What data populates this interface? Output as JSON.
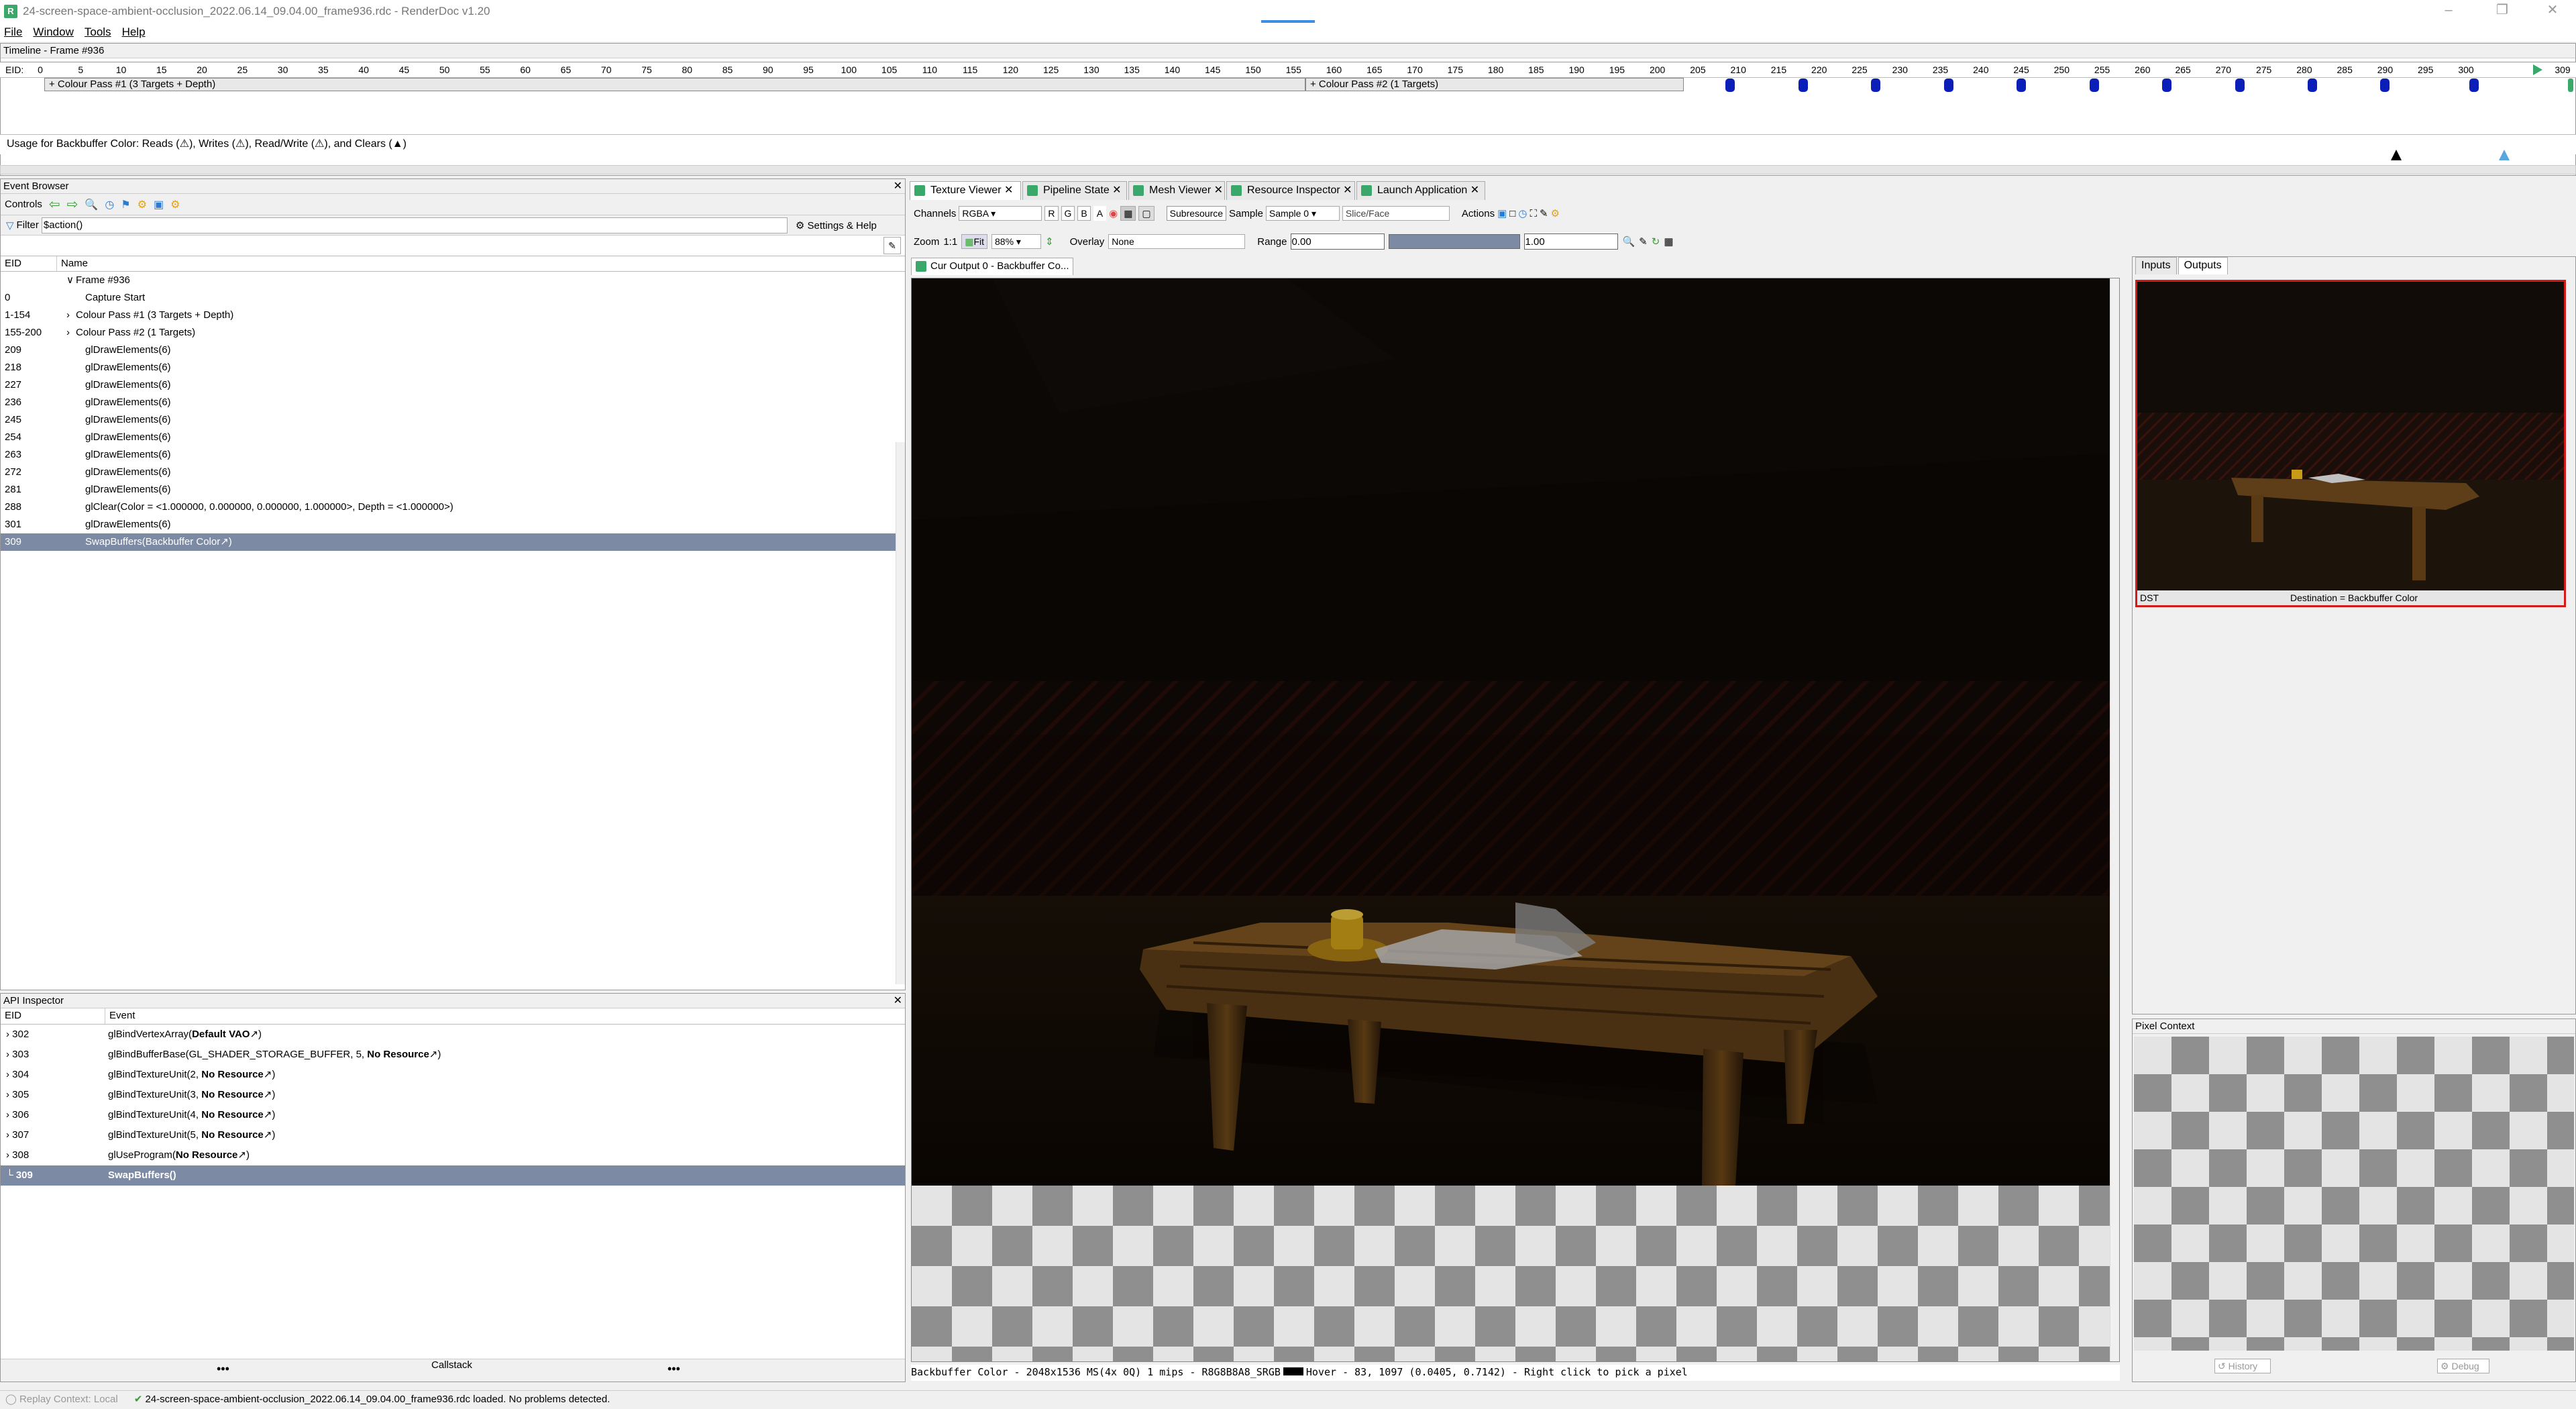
{
  "window": {
    "title": "24-screen-space-ambient-occlusion_2022.06.14_09.04.00_frame936.rdc - RenderDoc v1.20",
    "app_icon": "renderdoc-icon"
  },
  "menu": [
    "File",
    "Window",
    "Tools",
    "Help"
  ],
  "timeline": {
    "title": "Timeline - Frame #936",
    "eid_label": "EID:",
    "ticks": [
      "0",
      "5",
      "10",
      "15",
      "20",
      "25",
      "30",
      "35",
      "40",
      "45",
      "50",
      "55",
      "60",
      "65",
      "70",
      "75",
      "80",
      "85",
      "90",
      "95",
      "100",
      "105",
      "110",
      "115",
      "120",
      "125",
      "130",
      "135",
      "140",
      "145",
      "150",
      "155",
      "160",
      "165",
      "170",
      "175",
      "180",
      "185",
      "190",
      "195",
      "200",
      "205",
      "210",
      "215",
      "220",
      "225",
      "230",
      "235",
      "240",
      "245",
      "250",
      "255",
      "260",
      "265",
      "270",
      "275",
      "280",
      "285",
      "290",
      "295",
      "300",
      "309"
    ],
    "pass1": "+ Colour Pass #1 (3 Targets + Depth)",
    "pass2": "+ Colour Pass #2 (1 Targets)",
    "usage": "Usage for Backbuffer Color: Reads (⚠), Writes (⚠), Read/Write (⚠), and Clears (▲)"
  },
  "event_browser": {
    "title": "Event Browser",
    "controls_label": "Controls",
    "filter_label": "Filter",
    "filter_value": "$action()",
    "settings_label": "Settings & Help",
    "col_eid": "EID",
    "col_name": "Name",
    "rows": [
      {
        "eid": "",
        "name": "Frame #936",
        "indent": 1,
        "expander": "∨"
      },
      {
        "eid": "0",
        "name": "Capture Start",
        "indent": 2,
        "expander": ""
      },
      {
        "eid": "1-154",
        "name": "Colour Pass #1 (3 Targets + Depth)",
        "indent": 1,
        "expander": "›"
      },
      {
        "eid": "155-200",
        "name": "Colour Pass #2 (1 Targets)",
        "indent": 1,
        "expander": "›"
      },
      {
        "eid": "209",
        "name": "glDrawElements(6)",
        "indent": 2,
        "expander": ""
      },
      {
        "eid": "218",
        "name": "glDrawElements(6)",
        "indent": 2,
        "expander": ""
      },
      {
        "eid": "227",
        "name": "glDrawElements(6)",
        "indent": 2,
        "expander": ""
      },
      {
        "eid": "236",
        "name": "glDrawElements(6)",
        "indent": 2,
        "expander": ""
      },
      {
        "eid": "245",
        "name": "glDrawElements(6)",
        "indent": 2,
        "expander": ""
      },
      {
        "eid": "254",
        "name": "glDrawElements(6)",
        "indent": 2,
        "expander": ""
      },
      {
        "eid": "263",
        "name": "glDrawElements(6)",
        "indent": 2,
        "expander": ""
      },
      {
        "eid": "272",
        "name": "glDrawElements(6)",
        "indent": 2,
        "expander": ""
      },
      {
        "eid": "281",
        "name": "glDrawElements(6)",
        "indent": 2,
        "expander": ""
      },
      {
        "eid": "288",
        "name": "glClear(Color = <1.000000, 0.000000, 0.000000, 1.000000>, Depth = <1.000000>)",
        "indent": 2,
        "expander": ""
      },
      {
        "eid": "301",
        "name": "glDrawElements(6)",
        "indent": 2,
        "expander": ""
      },
      {
        "eid": "309",
        "name": "SwapBuffers(Backbuffer Color↗)",
        "indent": 2,
        "expander": "",
        "selected": true
      }
    ]
  },
  "api_inspector": {
    "title": "API Inspector",
    "col_eid": "EID",
    "col_event": "Event",
    "rows": [
      {
        "eid": "302",
        "pre": "glBindVertexArray(",
        "bold": "Default VAO",
        "post": "↗)"
      },
      {
        "eid": "303",
        "pre": "glBindBufferBase(GL_SHADER_STORAGE_BUFFER, 5, ",
        "bold": "No Resource",
        "post": "↗)"
      },
      {
        "eid": "304",
        "pre": "glBindTextureUnit(2, ",
        "bold": "No Resource",
        "post": "↗)"
      },
      {
        "eid": "305",
        "pre": "glBindTextureUnit(3, ",
        "bold": "No Resource",
        "post": "↗)"
      },
      {
        "eid": "306",
        "pre": "glBindTextureUnit(4, ",
        "bold": "No Resource",
        "post": "↗)"
      },
      {
        "eid": "307",
        "pre": "glBindTextureUnit(5, ",
        "bold": "No Resource",
        "post": "↗)"
      },
      {
        "eid": "308",
        "pre": "glUseProgram(",
        "bold": "No Resource",
        "post": "↗)"
      },
      {
        "eid": "309",
        "pre": "",
        "bold": "SwapBuffers()",
        "post": "",
        "selected": true
      }
    ],
    "callstack": "Callstack",
    "dots": "•••"
  },
  "tabs": [
    "Texture Viewer",
    "Pipeline State",
    "Mesh Viewer",
    "Resource Inspector",
    "Launch Application"
  ],
  "texture_viewer": {
    "channels_label": "Channels",
    "channels_value": "RGBA",
    "ch_r": "R",
    "ch_g": "G",
    "ch_b": "B",
    "ch_a": "A",
    "subresource_label": "Subresource",
    "sample_label": "Sample",
    "sample_value": "Sample 0",
    "slice_label": "Slice/Face",
    "actions_label": "Actions",
    "zoom_label": "Zoom",
    "zoom_11": "1:1",
    "fit_label": "Fit",
    "zoom_value": "88%",
    "overlay_label": "Overlay",
    "overlay_value": "None",
    "range_label": "Range",
    "range_min": "0.00",
    "range_max": "1.00",
    "output_tab": "Cur Output 0 - Backbuffer Co...",
    "status": "Backbuffer Color - 2048x1536 MS(4x 0Q) 1 mips - R8G8B8A8_SRGB",
    "hover": "Hover -    83, 1097 (0.0405, 0.7142)  - Right click to pick a pixel"
  },
  "right_panel": {
    "tab_inputs": "Inputs",
    "tab_outputs": "Outputs",
    "thumb_left": "DST",
    "thumb_right": "Destination = Backbuffer Color",
    "pixel_context": "Pixel Context",
    "history": "History",
    "debug": "Debug"
  },
  "statusbar": {
    "replay": "Replay Context: Local",
    "message": "24-screen-space-ambient-occlusion_2022.06.14_09.04.00_frame936.rdc loaded. No problems detected."
  },
  "colors": {
    "accent_selected": "#7d8aa3",
    "marker_blue": "#0b1fb8",
    "red_border": "#d11a1a",
    "renderdoc_green": "#3aa76b"
  }
}
